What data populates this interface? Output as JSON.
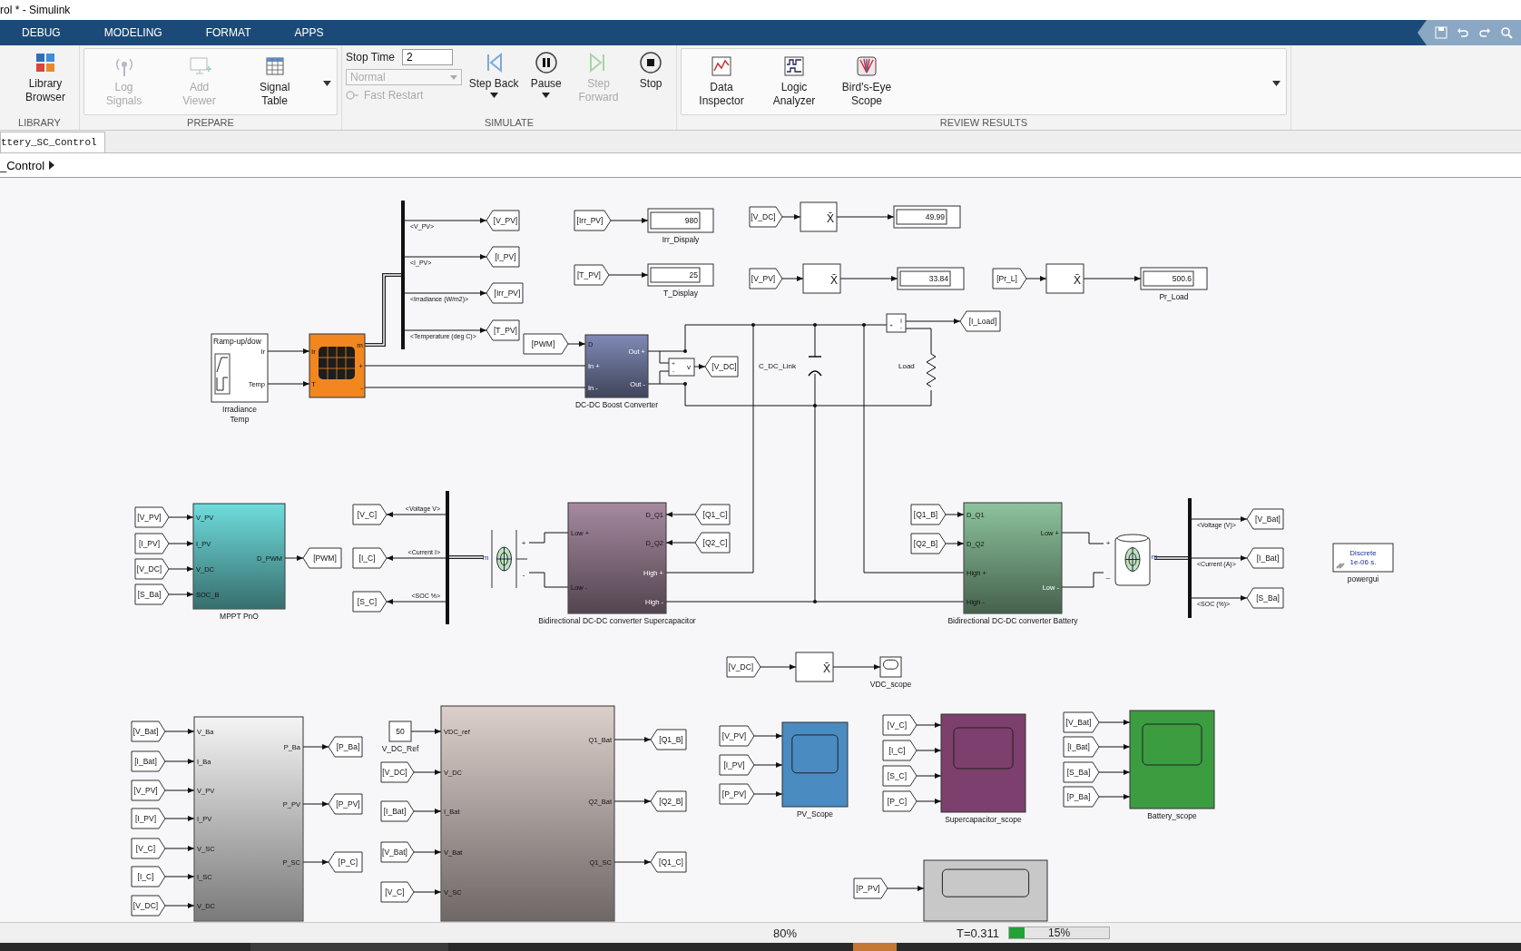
{
  "window": {
    "title": "rol * - Simulink"
  },
  "tabs": [
    {
      "label": "DEBUG",
      "selected": false
    },
    {
      "label": "MODELING",
      "selected": false
    },
    {
      "label": "FORMAT",
      "selected": false
    },
    {
      "label": "APPS",
      "selected": false
    }
  ],
  "toolstrip": {
    "sections": [
      {
        "label": "LIBRARY",
        "boxed": false,
        "items": [
          {
            "kind": "button",
            "label": "Library Browser",
            "disabled": false,
            "menu": false
          }
        ]
      },
      {
        "label": "PREPARE",
        "boxed": true,
        "items": [
          {
            "kind": "button",
            "label": "Log Signals",
            "disabled": true,
            "menu": false
          },
          {
            "kind": "button",
            "label": "Add Viewer",
            "disabled": true,
            "menu": false
          },
          {
            "kind": "button",
            "label": "Signal Table",
            "disabled": false,
            "menu": false
          }
        ]
      },
      {
        "label": "SIMULATE",
        "boxed": false,
        "items": [
          {
            "kind": "settings",
            "stop_time_label": "Stop Time",
            "stop_time": "2",
            "mode": "Normal",
            "mode_disabled": true,
            "fast_restart": "Fast Restart",
            "fast_restart_disabled": true
          },
          {
            "kind": "button",
            "label": "Step Back",
            "disabled": false,
            "menu": true
          },
          {
            "kind": "button",
            "label": "Pause",
            "disabled": false,
            "menu": true
          },
          {
            "kind": "button",
            "label": "Step Forward",
            "disabled": true,
            "menu": false
          },
          {
            "kind": "button",
            "label": "Stop",
            "disabled": false,
            "menu": false
          }
        ]
      },
      {
        "label": "REVIEW RESULTS",
        "boxed": true,
        "items": [
          {
            "kind": "button",
            "label": "Data Inspector",
            "disabled": false,
            "menu": false
          },
          {
            "kind": "button",
            "label": "Logic Analyzer",
            "disabled": false,
            "menu": false
          },
          {
            "kind": "button",
            "label": "Bird's-Eye Scope",
            "disabled": false,
            "menu": false
          }
        ]
      }
    ]
  },
  "model_tabs": [
    {
      "label": "ttery_SC_Control",
      "selected": true
    }
  ],
  "breadcrumb": {
    "path": "_Control"
  },
  "diagram": {
    "blocks": [
      {
        "kind": "signal_builder",
        "title": "Ramp-up/dow",
        "ports_right": [
          "Ir",
          "Temp"
        ],
        "label_lines": [
          "Irradiance",
          "Temp"
        ]
      },
      {
        "kind": "pv_array",
        "ports_left": [
          "Ir",
          "T"
        ],
        "ports_right": [
          "m",
          "+",
          "-"
        ]
      },
      {
        "kind": "bus_selector",
        "signals": [
          "<V_PV>",
          "<I_PV>",
          "<Irradiance (W/m2)>",
          "<Temperature (deg C)>"
        ]
      },
      {
        "kind": "goto",
        "label": "[V_PV]"
      },
      {
        "kind": "goto",
        "label": "[I_PV]"
      },
      {
        "kind": "goto",
        "label": "[Irr_PV]"
      },
      {
        "kind": "goto",
        "label": "[T_PV]"
      },
      {
        "kind": "from",
        "label": "[Irr_PV]"
      },
      {
        "kind": "display",
        "value": "980",
        "label": "Irr_Dispaly"
      },
      {
        "kind": "from",
        "label": "[T_PV]"
      },
      {
        "kind": "display",
        "value": "25",
        "label": "T_Display"
      },
      {
        "kind": "from",
        "label": "[V_DC]"
      },
      {
        "kind": "mean",
        "symbol": "X̄"
      },
      {
        "kind": "display",
        "value": "49.99"
      },
      {
        "kind": "from",
        "label": "[V_PV]"
      },
      {
        "kind": "mean",
        "symbol": "X̄"
      },
      {
        "kind": "display",
        "value": "33.84"
      },
      {
        "kind": "from",
        "label": "[Pr_L]"
      },
      {
        "kind": "mean",
        "symbol": "X̄"
      },
      {
        "kind": "display",
        "value": "500.6",
        "label": "Pr_Load"
      },
      {
        "kind": "from",
        "label": "[PWM]"
      },
      {
        "kind": "subsystem",
        "ports_left": [
          "D",
          "In +",
          "In -"
        ],
        "ports_right": [
          "Out +",
          "Out -"
        ],
        "label": "DC-DC Boost Converter",
        "color": "#7f89b5"
      },
      {
        "kind": "voltage_meter",
        "symbol": "v",
        "signs": [
          "+",
          "-"
        ]
      },
      {
        "kind": "goto",
        "label": "[V_DC]"
      },
      {
        "kind": "current_meter",
        "symbol": "i",
        "signs": [
          "+",
          "-"
        ]
      },
      {
        "kind": "goto",
        "label": "[I_Load]"
      },
      {
        "kind": "capacitor",
        "label": "C_DC_Link"
      },
      {
        "kind": "resistor",
        "label": "Load"
      },
      {
        "kind": "from",
        "label": "[V_PV]"
      },
      {
        "kind": "from",
        "label": "[I_PV]"
      },
      {
        "kind": "from",
        "label": "[V_DC]"
      },
      {
        "kind": "from",
        "label": "[S_Ba]"
      },
      {
        "kind": "subsystem",
        "ports_left": [
          "V_PV",
          "I_PV",
          "V_DC",
          "SOC_B"
        ],
        "ports_right": [
          "D_PWM"
        ],
        "label": "MPPT PnO",
        "color": "#6fdcdc"
      },
      {
        "kind": "goto",
        "label": "[PWM]"
      },
      {
        "kind": "goto",
        "label": "[V_C]"
      },
      {
        "kind": "goto",
        "label": "[I_C]"
      },
      {
        "kind": "goto",
        "label": "[S_C]"
      },
      {
        "kind": "bus_selector",
        "signals": [
          "<Voltage V>",
          "<Current I>",
          "<SOC %>"
        ]
      },
      {
        "kind": "supercapacitor",
        "port": "m",
        "terminals": [
          "+",
          "-"
        ]
      },
      {
        "kind": "subsystem",
        "ports_left": [
          "Low +",
          "Low -"
        ],
        "ports_right": [
          "D_Q1",
          "D_Q2",
          "High +",
          "High -"
        ],
        "label": "Bidirectional DC-DC converter Supercapacitor",
        "color": "#a6899f"
      },
      {
        "kind": "from",
        "label": "[Q1_C]"
      },
      {
        "kind": "from",
        "label": "[Q2_C]"
      },
      {
        "kind": "from",
        "label": "[Q1_B]"
      },
      {
        "kind": "from",
        "label": "[Q2_B]"
      },
      {
        "kind": "subsystem",
        "ports_left": [
          "D_Q1",
          "D_Q2",
          "High +",
          "High -"
        ],
        "ports_right": [
          "Low +",
          "Low -"
        ],
        "label": "Bidirectional DC-DC converter Battery",
        "color": "#8cc39c"
      },
      {
        "kind": "battery",
        "port": "m",
        "terminals": [
          "+",
          "_"
        ]
      },
      {
        "kind": "bus_selector",
        "signals": [
          "<Voltage (V)>",
          "<Current (A)>",
          "<SOC (%)>"
        ]
      },
      {
        "kind": "goto",
        "label": "[V_Bat]"
      },
      {
        "kind": "goto",
        "label": "[I_Bat]"
      },
      {
        "kind": "goto",
        "label": "[S_Ba]"
      },
      {
        "kind": "powergui",
        "lines": [
          "Discrete",
          "1e-06 s."
        ],
        "label": "powergui"
      },
      {
        "kind": "from",
        "label": "[V_DC]"
      },
      {
        "kind": "mean",
        "symbol": "X̄"
      },
      {
        "kind": "scope",
        "label": "VDC_scope",
        "color": "#ffffff"
      },
      {
        "kind": "from",
        "label": "[V_Bat]"
      },
      {
        "kind": "from",
        "label": "[I_Bat]"
      },
      {
        "kind": "from",
        "label": "[V_PV]"
      },
      {
        "kind": "from",
        "label": "[I_PV]"
      },
      {
        "kind": "from",
        "label": "[V_C]"
      },
      {
        "kind": "from",
        "label": "[I_C]"
      },
      {
        "kind": "from",
        "label": "[V_DC]"
      },
      {
        "kind": "subsystem",
        "ports_left": [
          "V_Ba",
          "I_Ba",
          "V_PV",
          "I_PV",
          "V_SC",
          "I_SC",
          "V_DC"
        ],
        "ports_right": [
          "P_Ba",
          "P_PV",
          "P_SC"
        ],
        "color": "#f4f4f4"
      },
      {
        "kind": "goto",
        "label": "[P_Ba]"
      },
      {
        "kind": "goto",
        "label": "[P_PV]"
      },
      {
        "kind": "goto",
        "label": "[P_C]"
      },
      {
        "kind": "constant",
        "value": "50",
        "label": "V_DC_Ref"
      },
      {
        "kind": "from",
        "label": "[V_DC]"
      },
      {
        "kind": "from",
        "label": "[I_Bat]"
      },
      {
        "kind": "from",
        "label": "[V_Bat]"
      },
      {
        "kind": "from",
        "label": "[V_C]"
      },
      {
        "kind": "subsystem",
        "ports_left": [
          "VDC_ref",
          "V_DC",
          "I_Bat",
          "V_Bat",
          "V_SC"
        ],
        "ports_right": [
          "Q1_Bat",
          "Q2_Bat",
          "Q1_SC"
        ],
        "color": "#dccfcb"
      },
      {
        "kind": "goto",
        "label": "[Q1_B]"
      },
      {
        "kind": "goto",
        "label": "[Q2_B]"
      },
      {
        "kind": "goto",
        "label": "[Q1_C]"
      },
      {
        "kind": "from",
        "label": "[V_PV]"
      },
      {
        "kind": "from",
        "label": "[I_PV]"
      },
      {
        "kind": "from",
        "label": "[P_PV]"
      },
      {
        "kind": "scope",
        "label": "PV_Scope",
        "color": "#4a8cc2"
      },
      {
        "kind": "from",
        "label": "[V_C]"
      },
      {
        "kind": "from",
        "label": "[I_C]"
      },
      {
        "kind": "from",
        "label": "[S_C]"
      },
      {
        "kind": "from",
        "label": "[P_C]"
      },
      {
        "kind": "scope",
        "label": "Supercapacitor_scope",
        "color": "#7d3f6d"
      },
      {
        "kind": "from",
        "label": "[V_Bat]"
      },
      {
        "kind": "from",
        "label": "[I_Bat]"
      },
      {
        "kind": "from",
        "label": "[S_Ba]"
      },
      {
        "kind": "from",
        "label": "[P_Ba]"
      },
      {
        "kind": "scope",
        "label": "Battery_scope",
        "color": "#3b9c40"
      },
      {
        "kind": "from",
        "label": "[P_PV]"
      },
      {
        "kind": "scope",
        "color": "#c8c8c8"
      }
    ]
  },
  "status_bar": {
    "zoom": "80%",
    "time": "T=0.311",
    "progress": {
      "level": 0.15,
      "reading": "15%"
    }
  }
}
